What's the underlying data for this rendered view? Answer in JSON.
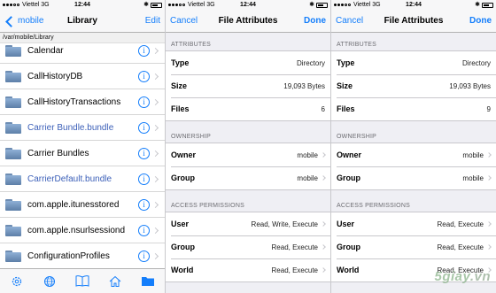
{
  "screen1": {
    "status": {
      "carrier": "Viettel",
      "network": "3G",
      "time": "12:44"
    },
    "nav": {
      "back_label": "mobile",
      "title": "Library",
      "right_label": "Edit"
    },
    "path": "/var/mobile/Library",
    "files": [
      {
        "name": "Calendar",
        "link": false
      },
      {
        "name": "CallHistoryDB",
        "link": false
      },
      {
        "name": "CallHistoryTransactions",
        "link": false
      },
      {
        "name": "Carrier Bundle.bundle",
        "link": true
      },
      {
        "name": "Carrier Bundles",
        "link": false
      },
      {
        "name": "CarrierDefault.bundle",
        "link": true
      },
      {
        "name": "com.apple.itunesstored",
        "link": false
      },
      {
        "name": "com.apple.nsurlsessiond",
        "link": false
      },
      {
        "name": "ConfigurationProfiles",
        "link": false
      }
    ],
    "tabbar": [
      "gear-icon",
      "globe-icon",
      "book-icon",
      "home-icon",
      "folder-icon"
    ]
  },
  "screen2": {
    "status": {
      "carrier": "Viettel",
      "network": "3G",
      "time": "12:44"
    },
    "nav": {
      "left_label": "Cancel",
      "title": "File Attributes",
      "right_label": "Done"
    },
    "attributes_header": "ATTRIBUTES",
    "attributes": [
      {
        "key": "Type",
        "value": "Directory"
      },
      {
        "key": "Size",
        "value": "19,093 Bytes"
      },
      {
        "key": "Files",
        "value": "6"
      }
    ],
    "ownership_header": "OWNERSHIP",
    "ownership": [
      {
        "key": "Owner",
        "value": "mobile"
      },
      {
        "key": "Group",
        "value": "mobile"
      }
    ],
    "permissions_header": "ACCESS PERMISSIONS",
    "permissions": [
      {
        "key": "User",
        "value": "Read, Write, Execute"
      },
      {
        "key": "Group",
        "value": "Read, Execute"
      },
      {
        "key": "World",
        "value": "Read, Execute"
      }
    ]
  },
  "screen3": {
    "status": {
      "carrier": "Viettel",
      "network": "3G",
      "time": "12:44"
    },
    "nav": {
      "left_label": "Cancel",
      "title": "File Attributes",
      "right_label": "Done"
    },
    "attributes_header": "ATTRIBUTES",
    "attributes": [
      {
        "key": "Type",
        "value": "Directory"
      },
      {
        "key": "Size",
        "value": "19,093 Bytes"
      },
      {
        "key": "Files",
        "value": "9"
      }
    ],
    "ownership_header": "OWNERSHIP",
    "ownership": [
      {
        "key": "Owner",
        "value": "mobile"
      },
      {
        "key": "Group",
        "value": "mobile"
      }
    ],
    "permissions_header": "ACCESS PERMISSIONS",
    "permissions": [
      {
        "key": "User",
        "value": "Read, Execute"
      },
      {
        "key": "Group",
        "value": "Read, Execute"
      },
      {
        "key": "World",
        "value": "Read, Execute"
      }
    ]
  },
  "watermark": {
    "a": "5giay",
    "b": ".vn"
  },
  "colors": {
    "accent": "#147efb",
    "link": "#3b5fb8",
    "grouped_bg": "#efeff4"
  }
}
